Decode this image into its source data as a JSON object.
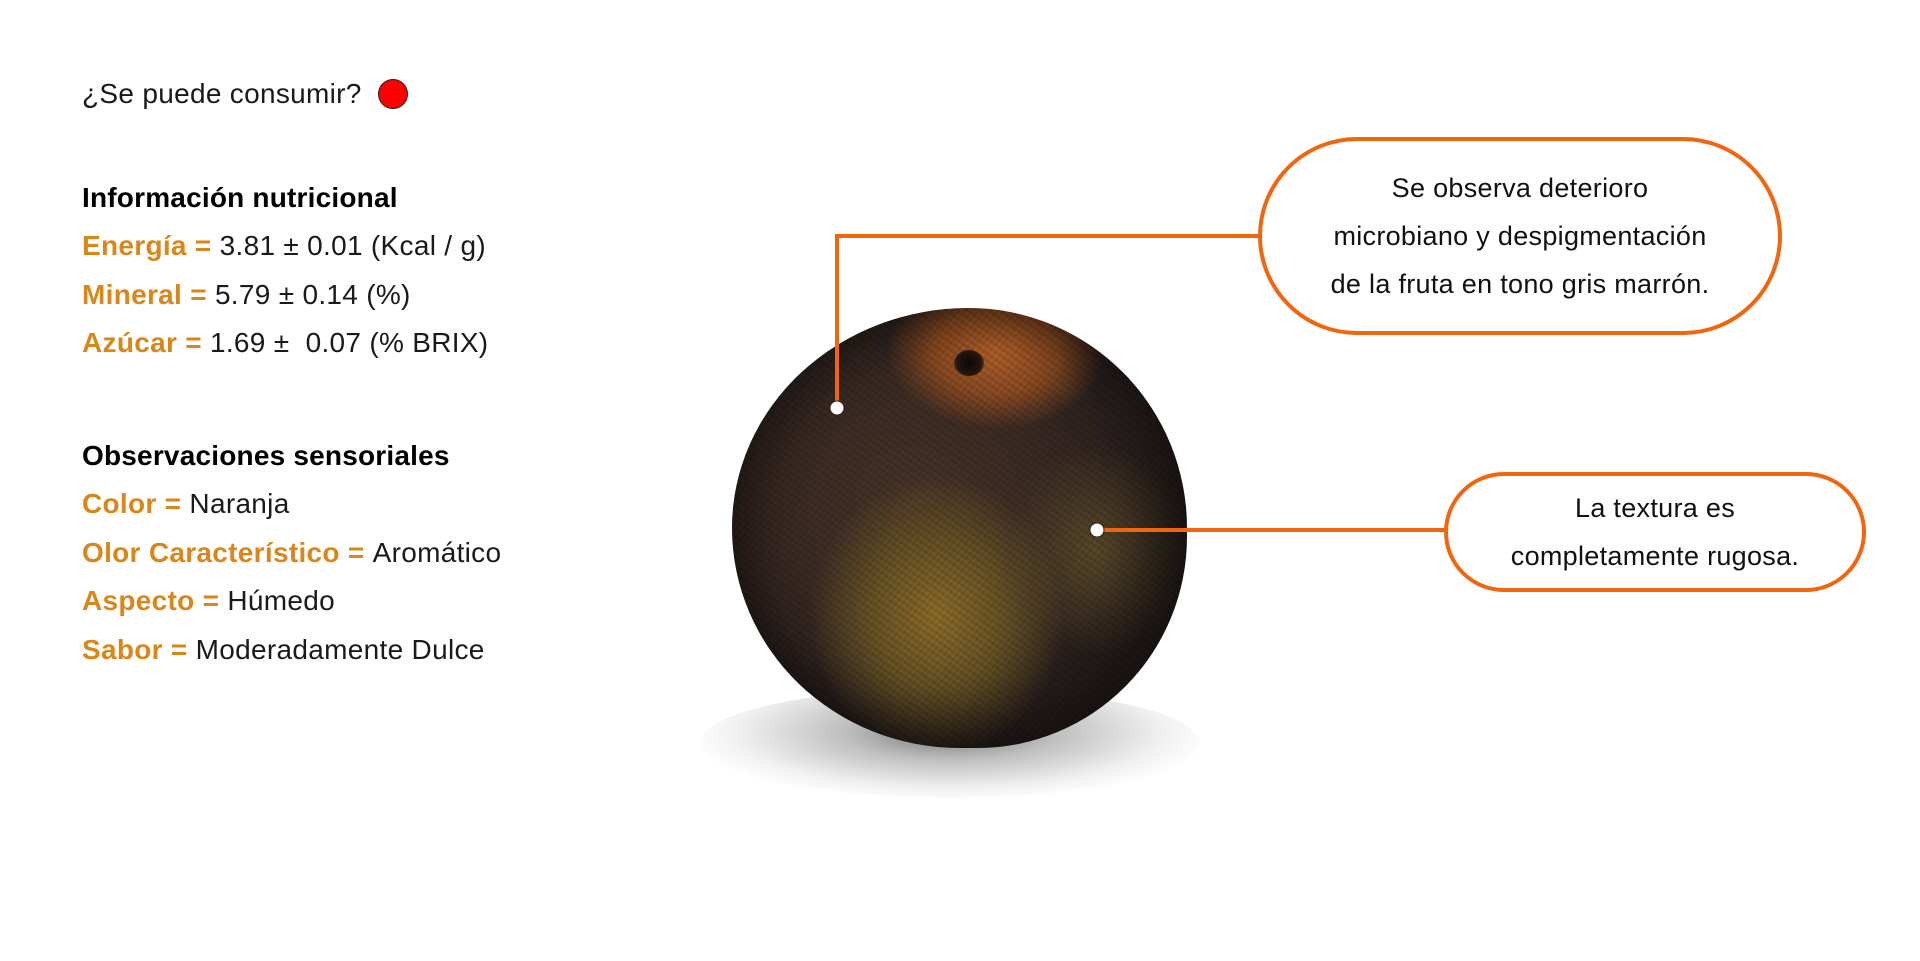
{
  "edibility": {
    "question": "¿Se puede consumir?",
    "indicator_color": "#ff0000"
  },
  "nutrition": {
    "heading": "Información nutricional",
    "items": [
      {
        "key": "Energía = ",
        "value": "3.81 ± 0.01 (Kcal / g)"
      },
      {
        "key": "Mineral = ",
        "value": "5.79 ± 0.14 (%)"
      },
      {
        "key": "Azúcar = ",
        "value": "1.69 ±  0.07 (% BRIX)"
      }
    ]
  },
  "sensory": {
    "heading": "Observaciones sensoriales",
    "items": [
      {
        "key": "Color = ",
        "value": "Naranja"
      },
      {
        "key": "Olor Característico = ",
        "value": "Aromático"
      },
      {
        "key": "Aspecto = ",
        "value": "Húmedo"
      },
      {
        "key": "Sabor = ",
        "value": "Moderadamente Dulce"
      }
    ]
  },
  "callouts": {
    "deterioro": {
      "lines": [
        "Se observa deterioro",
        "microbiano y despigmentación",
        "de la fruta en tono gris marrón."
      ]
    },
    "textura": {
      "lines": [
        "La textura es",
        "completamente rugosa."
      ]
    }
  },
  "colors": {
    "key_label": "#d9861a",
    "accent": "#f2650f",
    "indicator": "#ff0000"
  }
}
